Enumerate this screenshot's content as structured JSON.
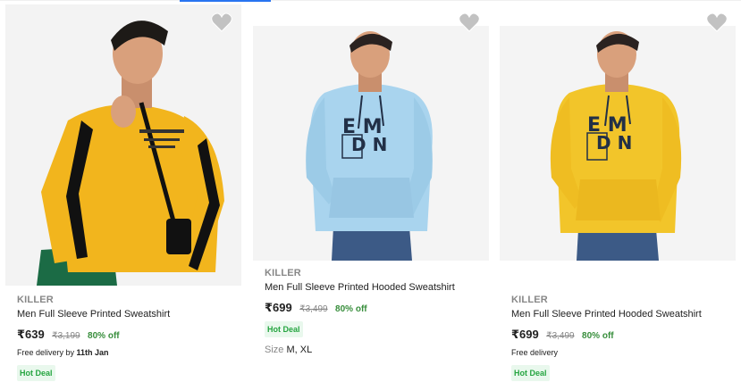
{
  "products": [
    {
      "brand": "KILLER",
      "title": "Men Full Sleeve Printed Sweatshirt",
      "price": "₹639",
      "mrp": "₹3,199",
      "discount": "80% off",
      "delivery_prefix": "Free delivery by ",
      "delivery_date": "11th Jan",
      "badge": "Hot Deal",
      "image": "yellow sweatshirt with black sleeve stripes",
      "colors": {
        "garment": "#f2b51d",
        "accent": "#111111"
      }
    },
    {
      "brand": "KILLER",
      "title": "Men Full Sleeve Printed Hooded Sweatshirt",
      "price": "₹699",
      "mrp": "₹3,499",
      "discount": "80% off",
      "badge": "Hot Deal",
      "size_label": "Size",
      "sizes": "M, XL",
      "image": "light blue printed hooded sweatshirt",
      "colors": {
        "garment": "#a9d4ee",
        "accent": "#223047"
      }
    },
    {
      "brand": "KILLER",
      "title": "Men Full Sleeve Printed Hooded Sweatshirt",
      "price": "₹699",
      "mrp": "₹3,499",
      "discount": "80% off",
      "delivery_prefix": "Free delivery",
      "badge": "Hot Deal",
      "image": "yellow printed hooded sweatshirt",
      "colors": {
        "garment": "#f2c52a",
        "accent": "#223047"
      }
    }
  ],
  "icons": {
    "wishlist": "heart-icon"
  },
  "colors": {
    "accent_blue": "#2874f0",
    "discount_green": "#388e3c",
    "badge_green": "#26a541",
    "muted": "#878787"
  }
}
